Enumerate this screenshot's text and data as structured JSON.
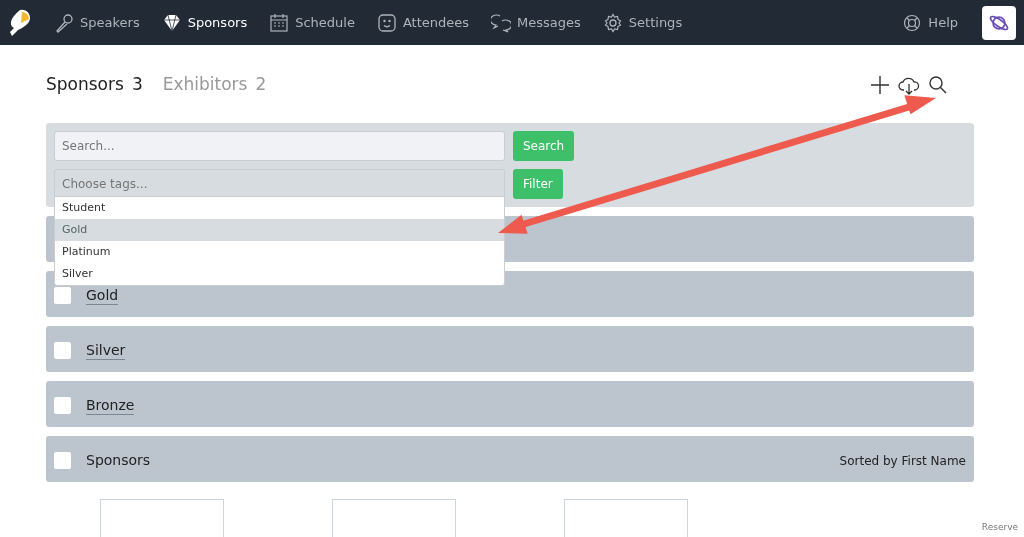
{
  "nav": {
    "items": [
      {
        "label": "Speakers",
        "selected": false
      },
      {
        "label": "Sponsors",
        "selected": true
      },
      {
        "label": "Schedule",
        "selected": false
      },
      {
        "label": "Attendees",
        "selected": false
      },
      {
        "label": "Messages",
        "selected": false
      },
      {
        "label": "Settings",
        "selected": false
      }
    ],
    "help": "Help"
  },
  "tabs": [
    {
      "label": "Sponsors",
      "count": "3",
      "selected": true
    },
    {
      "label": "Exhibitors",
      "count": "2",
      "selected": false
    }
  ],
  "filter": {
    "search_placeholder": "Search...",
    "search_button": "Search",
    "tags_placeholder": "Choose tags...",
    "filter_button": "Filter",
    "tag_options": [
      {
        "label": "Student",
        "selected": false
      },
      {
        "label": "Gold",
        "selected": true
      },
      {
        "label": "Platinum",
        "selected": false
      },
      {
        "label": "Silver",
        "selected": false
      }
    ]
  },
  "groups": [
    {
      "kind": "tier",
      "name": "Gold",
      "checked": false
    },
    {
      "kind": "tier",
      "name": "Silver",
      "checked": false
    },
    {
      "kind": "tier",
      "name": "Bronze",
      "checked": false
    },
    {
      "kind": "all",
      "name": "Sponsors",
      "sort": "Sorted by First Name",
      "checked": false
    }
  ],
  "footer": "Reserve"
}
